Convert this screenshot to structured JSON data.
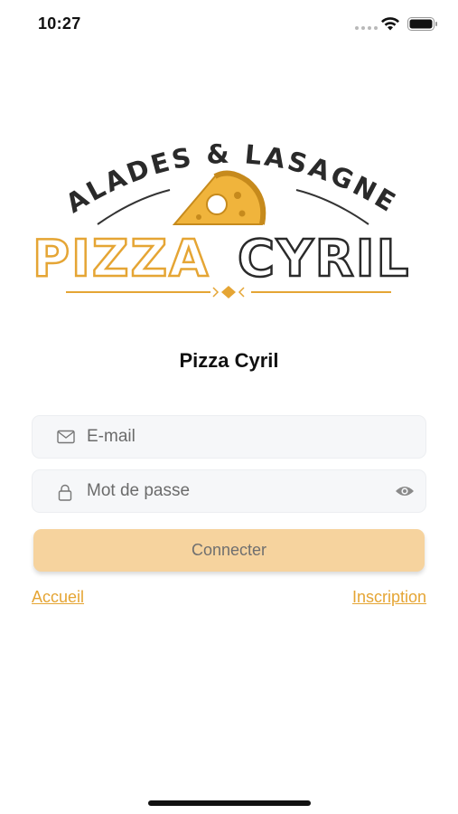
{
  "status_bar": {
    "time": "10:27",
    "icons": [
      "cellular-dots-icon",
      "wifi-icon",
      "battery-icon"
    ]
  },
  "logo": {
    "tagline": "SALADES & LASAGNES",
    "word_left": "PIZZA",
    "word_right": "CYRIL",
    "icons": [
      "pizza-slice-icon"
    ]
  },
  "app_title": "Pizza Cyril",
  "form": {
    "email": {
      "value": "",
      "placeholder": "E-mail",
      "icon": "mail-icon"
    },
    "password": {
      "value": "",
      "placeholder": "Mot de passe",
      "icon": "lock-icon",
      "toggle_icon": "eye-icon"
    },
    "submit_label": "Connecter"
  },
  "links": {
    "home": "Accueil",
    "signup": "Inscription"
  },
  "colors": {
    "accent": "#e5a534",
    "button": "#f6d39e",
    "field_bg": "#f6f7f9"
  }
}
